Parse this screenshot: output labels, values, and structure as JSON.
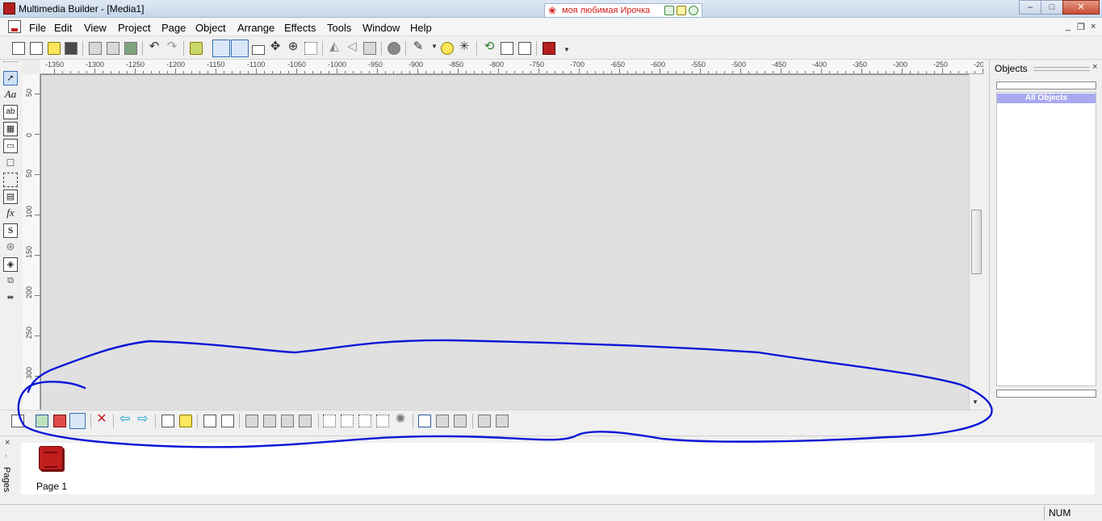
{
  "window": {
    "title": "Multimedia Builder - [Media1]",
    "tray_text": "моя любимая Ирочка",
    "controls": {
      "minimize": "–",
      "maximize": "□",
      "close": "✕"
    }
  },
  "menu": {
    "items": [
      "File",
      "Edit",
      "View",
      "Project",
      "Page",
      "Object",
      "Arrange",
      "Effects",
      "Tools",
      "Window",
      "Help"
    ],
    "right_controls": [
      "_",
      "❐",
      "×"
    ]
  },
  "rulers": {
    "horizontal": [
      "-1350",
      "-1300",
      "-1250",
      "-1200",
      "-1150",
      "-1100",
      "-1050",
      "-1000",
      "-950",
      "-900",
      "-850",
      "-800",
      "-750",
      "-700",
      "-650",
      "-600",
      "-550",
      "-500",
      "-450",
      "-400",
      "-350",
      "-300",
      "-250",
      "-20"
    ],
    "vertical": [
      "50",
      "0",
      "50",
      "100",
      "150",
      "200",
      "250",
      "300"
    ]
  },
  "tools": {
    "text_tool": "Aa",
    "label_tool": "ab",
    "fx_tool": "fx",
    "script_tool": "S"
  },
  "objects_panel": {
    "title": "Objects",
    "close": "×",
    "all_objects": "All Objects"
  },
  "pages_panel": {
    "label": "Pages",
    "close": "×",
    "pages": [
      {
        "name": "Page 1"
      }
    ]
  },
  "status": {
    "num": "NUM"
  },
  "colors": {
    "annotation": "#0b17d6",
    "canvas": "#e0e0e0",
    "page_icon": "#c11e1e"
  }
}
